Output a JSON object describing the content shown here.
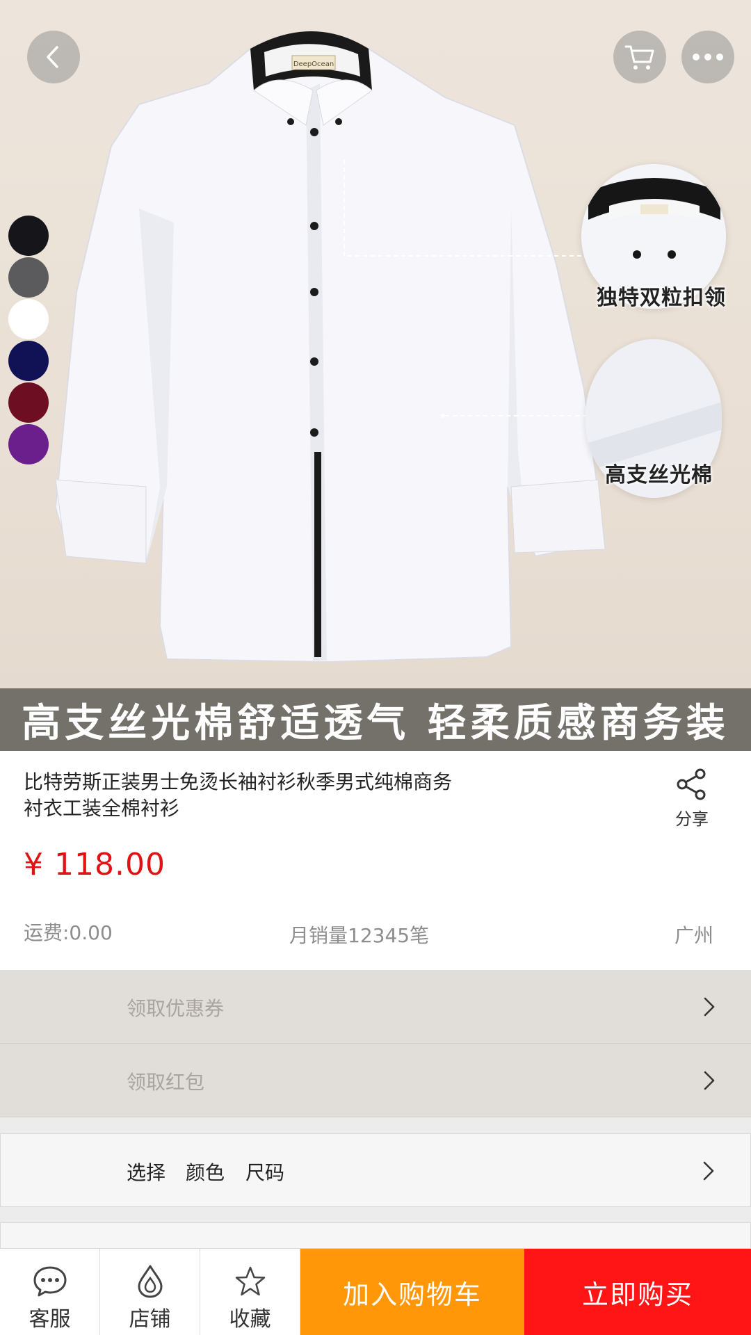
{
  "hero": {
    "banner_text": "高支丝光棉舒适透气 轻柔质感商务装",
    "collar_label": "独特双粒扣领",
    "fabric_label": "高支丝光棉",
    "brand_tag": "DeepOcean",
    "swatch_colors": [
      "#16161a",
      "#5b5b5d",
      "#ffffff",
      "#111155",
      "#6e0e22",
      "#6a1f8c"
    ]
  },
  "product": {
    "title": "比特劳斯正装男士免烫长袖衬衫秋季男式纯棉商务衬衣工装全棉衬衫",
    "price": "¥ 118.00",
    "shipping": "运费:0.00",
    "monthly_sales": "月销量12345笔",
    "location": "广州",
    "share_label": "分享"
  },
  "rows": {
    "coupon_label": "领取优惠券",
    "red_packet_label": "领取红包",
    "select_label": "选择",
    "select_color": "颜色",
    "select_size": "尺码"
  },
  "bottom_bar": {
    "service_label": "客服",
    "shop_label": "店铺",
    "favorite_label": "收藏",
    "add_cart_label": "加入购物车",
    "buy_now_label": "立即购买"
  },
  "colors": {
    "price_red": "#e11212",
    "add_cart_orange": "#ff9708",
    "buy_now_red": "#ff1515"
  }
}
